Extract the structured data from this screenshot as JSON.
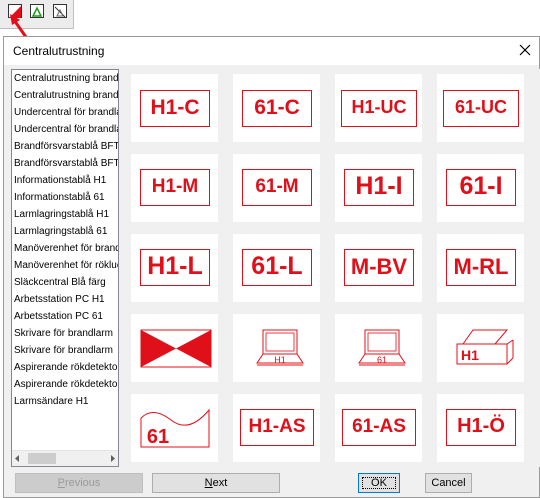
{
  "dialog": {
    "title": "Centralutrustning"
  },
  "list": {
    "items": [
      "Centralutrustning brandlarm",
      "Centralutrustning brandlarm",
      "Undercentral för brandlarm",
      "Undercentral för brandlarm",
      "Brandförsvarstablå BFT",
      "Brandförsvarstablå BFT",
      "Informationstablå H1",
      "Informationstablå 61",
      "Larmlagringstablå H1",
      "Larmlagringstablå 61",
      "Manöverenhet för brandlarm",
      "Manöverenhet för rökluckor",
      "Släckcentral Blå färg",
      "Arbetsstation PC H1",
      "Arbetsstation PC 61",
      "Skrivare för brandlarm",
      "Skrivare för brandlarm",
      "Aspirerande rökdetektor",
      "Aspirerande rökdetektor",
      "Larmsändare H1"
    ]
  },
  "symbols": {
    "h1c": "H1-C",
    "c61": "61-C",
    "h1uc": "H1-UC",
    "uc61": "61-UC",
    "h1m": "H1-M",
    "m61": "61-M",
    "h1i": "H1-I",
    "i61": "61-I",
    "h1l": "H1-L",
    "l61": "61-L",
    "mbv": "M-BV",
    "mrl": "M-RL",
    "pc_h1": "H1",
    "pc_61": "61",
    "printer_h1": "H1",
    "asp61": "61",
    "h1as": "H1-AS",
    "as61": "61-AS",
    "h1o": "H1-Ö"
  },
  "buttons": {
    "previous_rest": "revious",
    "previous_key": "P",
    "next_rest": "ext",
    "next_key": "N",
    "ok": "OK",
    "cancel": "Cancel"
  },
  "colors": {
    "symbol_red": "#e0101a",
    "dialog_bg": "#f0f0f0"
  },
  "icons": [
    "red-symbol-icon",
    "green-symbol-icon",
    "crossed-symbol-icon",
    "close-icon"
  ]
}
